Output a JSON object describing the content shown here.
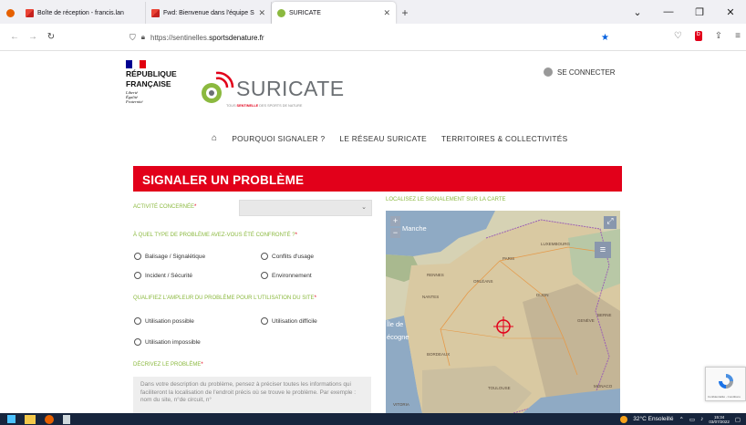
{
  "browser": {
    "tabs": [
      {
        "title": "Boîte de réception - francis.lan",
        "active": false
      },
      {
        "title": "Fwd: Bienvenue dans l'équipe S",
        "active": false
      },
      {
        "title": "SURICATE",
        "active": true
      }
    ],
    "new_tab": "+",
    "url": {
      "prefix": "https://sentinelles.",
      "domain": "sportsdenature.fr"
    }
  },
  "header": {
    "republique": "RÉPUBLIQUE",
    "francaise": "FRANÇAISE",
    "motto": [
      "Liberté",
      "Égalité",
      "Fraternité"
    ],
    "logo_word": "SURICATE",
    "logo_tag_prefix": "TOUS ",
    "logo_tag_bold": "SENTINELLE",
    "logo_tag_suffix": " DES SPORTS DE NATURE",
    "login": "SE CONNECTER"
  },
  "menu": {
    "items": [
      "POURQUOI SIGNALER ?",
      "LE RÉSEAU SURICATE",
      "TERRITOIRES & COLLECTIVITÉS"
    ]
  },
  "form": {
    "title": "SIGNALER UN PROBLÈME",
    "activity_label": "ACTIVITÉ CONCERNÉE",
    "problem_type_label": "À QUEL TYPE DE PROBLÈME AVEZ-VOUS ÉTÉ CONFRONTÉ ?",
    "problem_types": [
      "Balisage / Signalétique",
      "Conflits d'usage",
      "Incident / Sécurité",
      "Environnement"
    ],
    "impact_label": "QUALIFIEZ L'AMPLEUR DU PROBLÈME POUR L'UTILISATION DU SITE",
    "impacts": [
      "Utilisation possible",
      "Utilisation difficile",
      "Utilisation impossible"
    ],
    "describe_label": "DÉCRIVEZ LE PROBLÈME",
    "describe_placeholder": "Dans votre description du problème, pensez à préciser toutes les informations qui faciliteront la localisation de l'endroit précis où se trouve le problème. Par exemple : nom du site, n°de circuit, n°",
    "required_mark": "*"
  },
  "map": {
    "label": "LOCALISEZ LE SIGNALEMENT SUR LA CARTE",
    "zoom_in": "+",
    "zoom_out": "−",
    "places": [
      "Manche",
      "LUXEMBOURG",
      "PARIS",
      "RENNES",
      "ORLÉANS",
      "NANTES",
      "DIJON",
      "BERNE",
      "GENÈVE",
      "BORDEAUX",
      "TOULOUSE",
      "MONACO",
      "VITORIA",
      "Île de",
      "écogne"
    ]
  },
  "recaptcha": {
    "text": "Confidentialité - Conditions"
  },
  "taskbar": {
    "weather": "32°C Ensoleillé",
    "time": "15:34",
    "date": "03/07/2022"
  }
}
